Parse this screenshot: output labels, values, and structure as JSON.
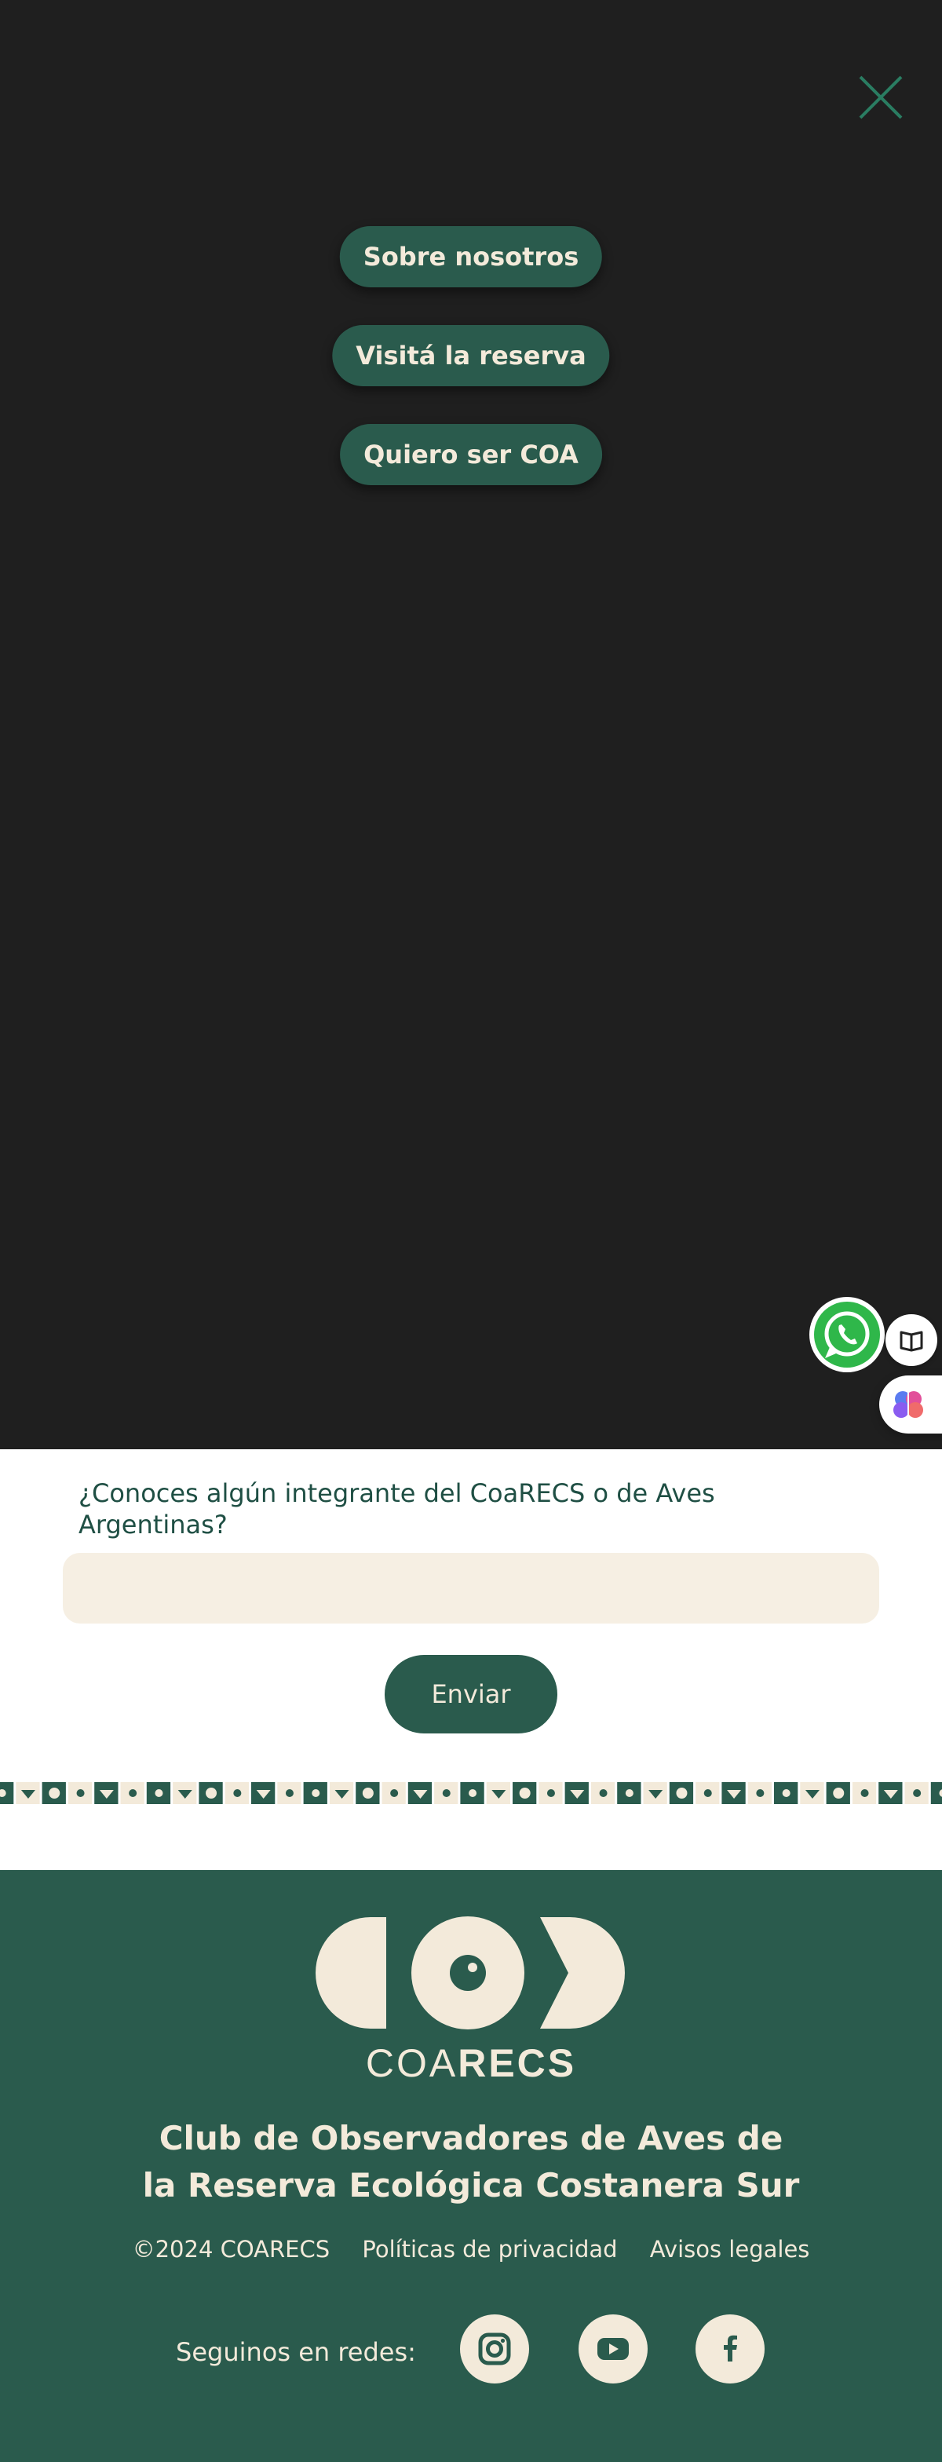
{
  "menu": {
    "items": [
      {
        "label": "Sobre nosotros"
      },
      {
        "label": "Visitá la reserva"
      },
      {
        "label": "Quiero ser COA"
      }
    ]
  },
  "form": {
    "question": "¿Conoces algún integrante del CoaRECS o de Aves Argentinas?",
    "answer_value": "",
    "send_label": "Enviar"
  },
  "footer": {
    "logo_text_light": "COA",
    "logo_text_bold": "RECS",
    "title_line1": "Club de Observadores de Aves de",
    "title_line2": "la Reserva Ecológica Costanera Sur",
    "copyright": "©2024 COARECS",
    "privacy_label": "Políticas de privacidad",
    "legal_label": "Avisos legales",
    "social_label": "Seguinos en redes:"
  },
  "colors": {
    "overlay": "#1f1f1f",
    "brand_green": "#2a5b4d",
    "cream": "#f3eada",
    "input_bg": "#f6efe3",
    "whatsapp": "#2fb74a"
  },
  "icons": [
    "close-icon",
    "whatsapp-icon",
    "reader-icon",
    "brain-icon",
    "instagram-icon",
    "youtube-icon",
    "facebook-icon"
  ]
}
